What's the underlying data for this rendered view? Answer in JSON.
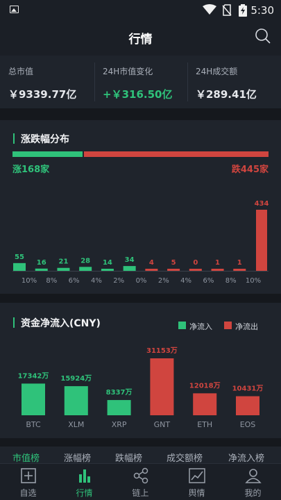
{
  "status_bar": {
    "time": "5:30",
    "icons": [
      "image-icon",
      "wifi-icon",
      "no-sim-icon",
      "battery-charging-icon"
    ]
  },
  "header": {
    "title": "行情",
    "search_icon": "search-icon"
  },
  "summary": {
    "items": [
      {
        "label": "总市值",
        "value": "￥9339.77亿"
      },
      {
        "label": "24H市值变化",
        "value": "+￥316.50亿"
      },
      {
        "label": "24H成交额",
        "value": "￥289.41亿"
      }
    ]
  },
  "colors": {
    "up": "#2fc27a",
    "down": "#d0453f",
    "panel": "#1f242c",
    "bg": "#1b1f26"
  },
  "distribution": {
    "title": "涨跌幅分布",
    "up_label": "涨168家",
    "down_label": "跌445家",
    "up_count": 168,
    "down_count": 445,
    "chart_data": {
      "type": "bar",
      "categories": [
        "10%",
        "8%",
        "6%",
        "4%",
        "2%",
        "0%",
        "2%",
        "4%",
        "6%",
        "8%",
        "10%"
      ],
      "values": [
        55,
        16,
        21,
        28,
        14,
        34,
        4,
        5,
        0,
        1,
        1,
        434
      ],
      "colors": [
        "up",
        "up",
        "up",
        "up",
        "up",
        "up",
        "down",
        "down",
        "down",
        "down",
        "down",
        "down"
      ]
    }
  },
  "flow": {
    "title": "资金净流入(CNY)",
    "legend": [
      {
        "label": "净流入",
        "color": "up"
      },
      {
        "label": "净流出",
        "color": "down"
      }
    ],
    "chart_data": {
      "type": "bar",
      "categories": [
        "BTC",
        "XLM",
        "XRP",
        "GNT",
        "ETH",
        "EOS"
      ],
      "values": [
        17342,
        15924,
        8337,
        31153,
        12018,
        10431
      ],
      "value_labels": [
        "17342万",
        "15924万",
        "8337万",
        "31153万",
        "12018万",
        "10431万"
      ],
      "directions": [
        "up",
        "up",
        "up",
        "down",
        "down",
        "down"
      ]
    }
  },
  "tabs": [
    {
      "label": "市值榜",
      "active": true
    },
    {
      "label": "涨幅榜",
      "active": false
    },
    {
      "label": "跌幅榜",
      "active": false
    },
    {
      "label": "成交额榜",
      "active": false
    },
    {
      "label": "净流入榜",
      "active": false
    }
  ],
  "bottom_nav": [
    {
      "label": "自选",
      "icon": "add-watchlist-icon",
      "active": false
    },
    {
      "label": "行情",
      "icon": "bar-chart-icon",
      "active": true
    },
    {
      "label": "链上",
      "icon": "nodes-icon",
      "active": false
    },
    {
      "label": "舆情",
      "icon": "trend-icon",
      "active": false
    },
    {
      "label": "我的",
      "icon": "profile-icon",
      "active": false
    }
  ]
}
